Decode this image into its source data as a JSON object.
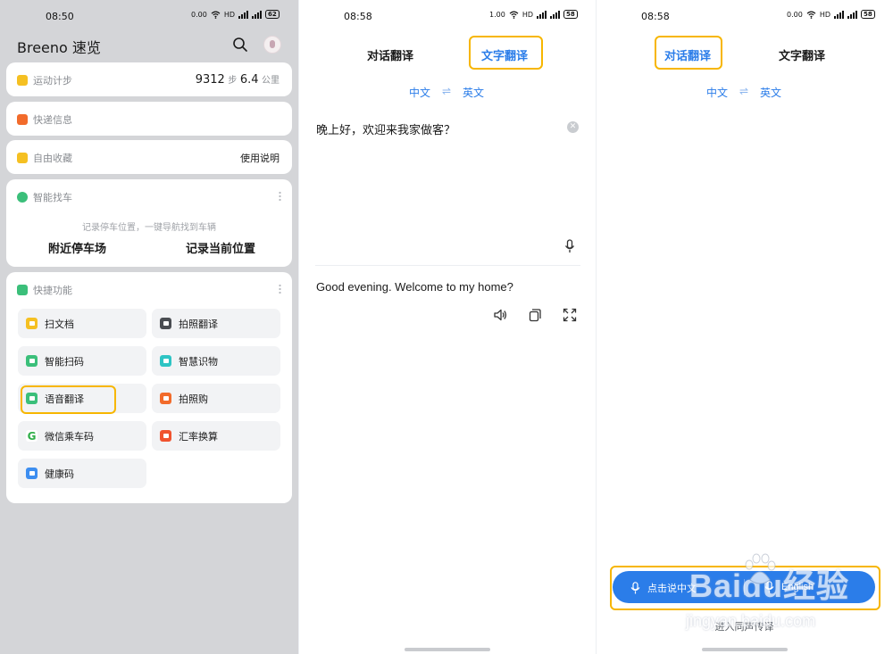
{
  "status_left": {
    "time": "08:50",
    "net": "0.00",
    "battery": "62"
  },
  "status_mid": {
    "time": "08:58",
    "net": "1.00",
    "battery": "58"
  },
  "status_right": {
    "time": "08:58",
    "net": "0.00",
    "battery": "58"
  },
  "status_common": {
    "hd": "HD",
    "g1": "4G",
    "g2": "4G"
  },
  "panel1": {
    "title": "Breeno 速览",
    "steps": {
      "label": "运动计步",
      "count": "9312",
      "unit": "步",
      "distance": "6.4",
      "distance_unit": "公里"
    },
    "express": {
      "label": "快递信息"
    },
    "collect": {
      "label": "自由收藏",
      "action": "使用说明"
    },
    "car": {
      "label": "智能找车",
      "hint": "记录停车位置，一键导航找到车辆",
      "nearby": "附近停车场",
      "record": "记录当前位置"
    },
    "shortcuts": {
      "label": "快捷功能",
      "items": [
        {
          "label": "扫文档"
        },
        {
          "label": "拍照翻译"
        },
        {
          "label": "智能扫码"
        },
        {
          "label": "智慧识物"
        },
        {
          "label": "语音翻译"
        },
        {
          "label": "拍照购"
        },
        {
          "label": "微信乘车码"
        },
        {
          "label": "汇率换算"
        },
        {
          "label": "健康码"
        }
      ]
    }
  },
  "panel2": {
    "tabs": [
      {
        "label": "对话翻译"
      },
      {
        "label": "文字翻译"
      }
    ],
    "lang_from": "中文",
    "swap": "⇌",
    "lang_to": "英文",
    "source_text": "晚上好，欢迎来我家做客？",
    "translated_text": "Good evening. Welcome to my home?"
  },
  "panel3": {
    "tabs": [
      {
        "label": "对话翻译"
      },
      {
        "label": "文字翻译"
      }
    ],
    "lang_from": "中文",
    "swap": "⇌",
    "lang_to": "英文",
    "btn_cn": "点击说中文",
    "btn_en": "English",
    "hint": "进入同声传译"
  },
  "watermark": {
    "brand": "Baidu经验",
    "url": "jingyan.baidu.com"
  },
  "colors": {
    "accent": "#2b7de9",
    "highlight": "#f7b600",
    "card_bg": "#ffffff",
    "dim_bg": "#d4d5d8"
  }
}
